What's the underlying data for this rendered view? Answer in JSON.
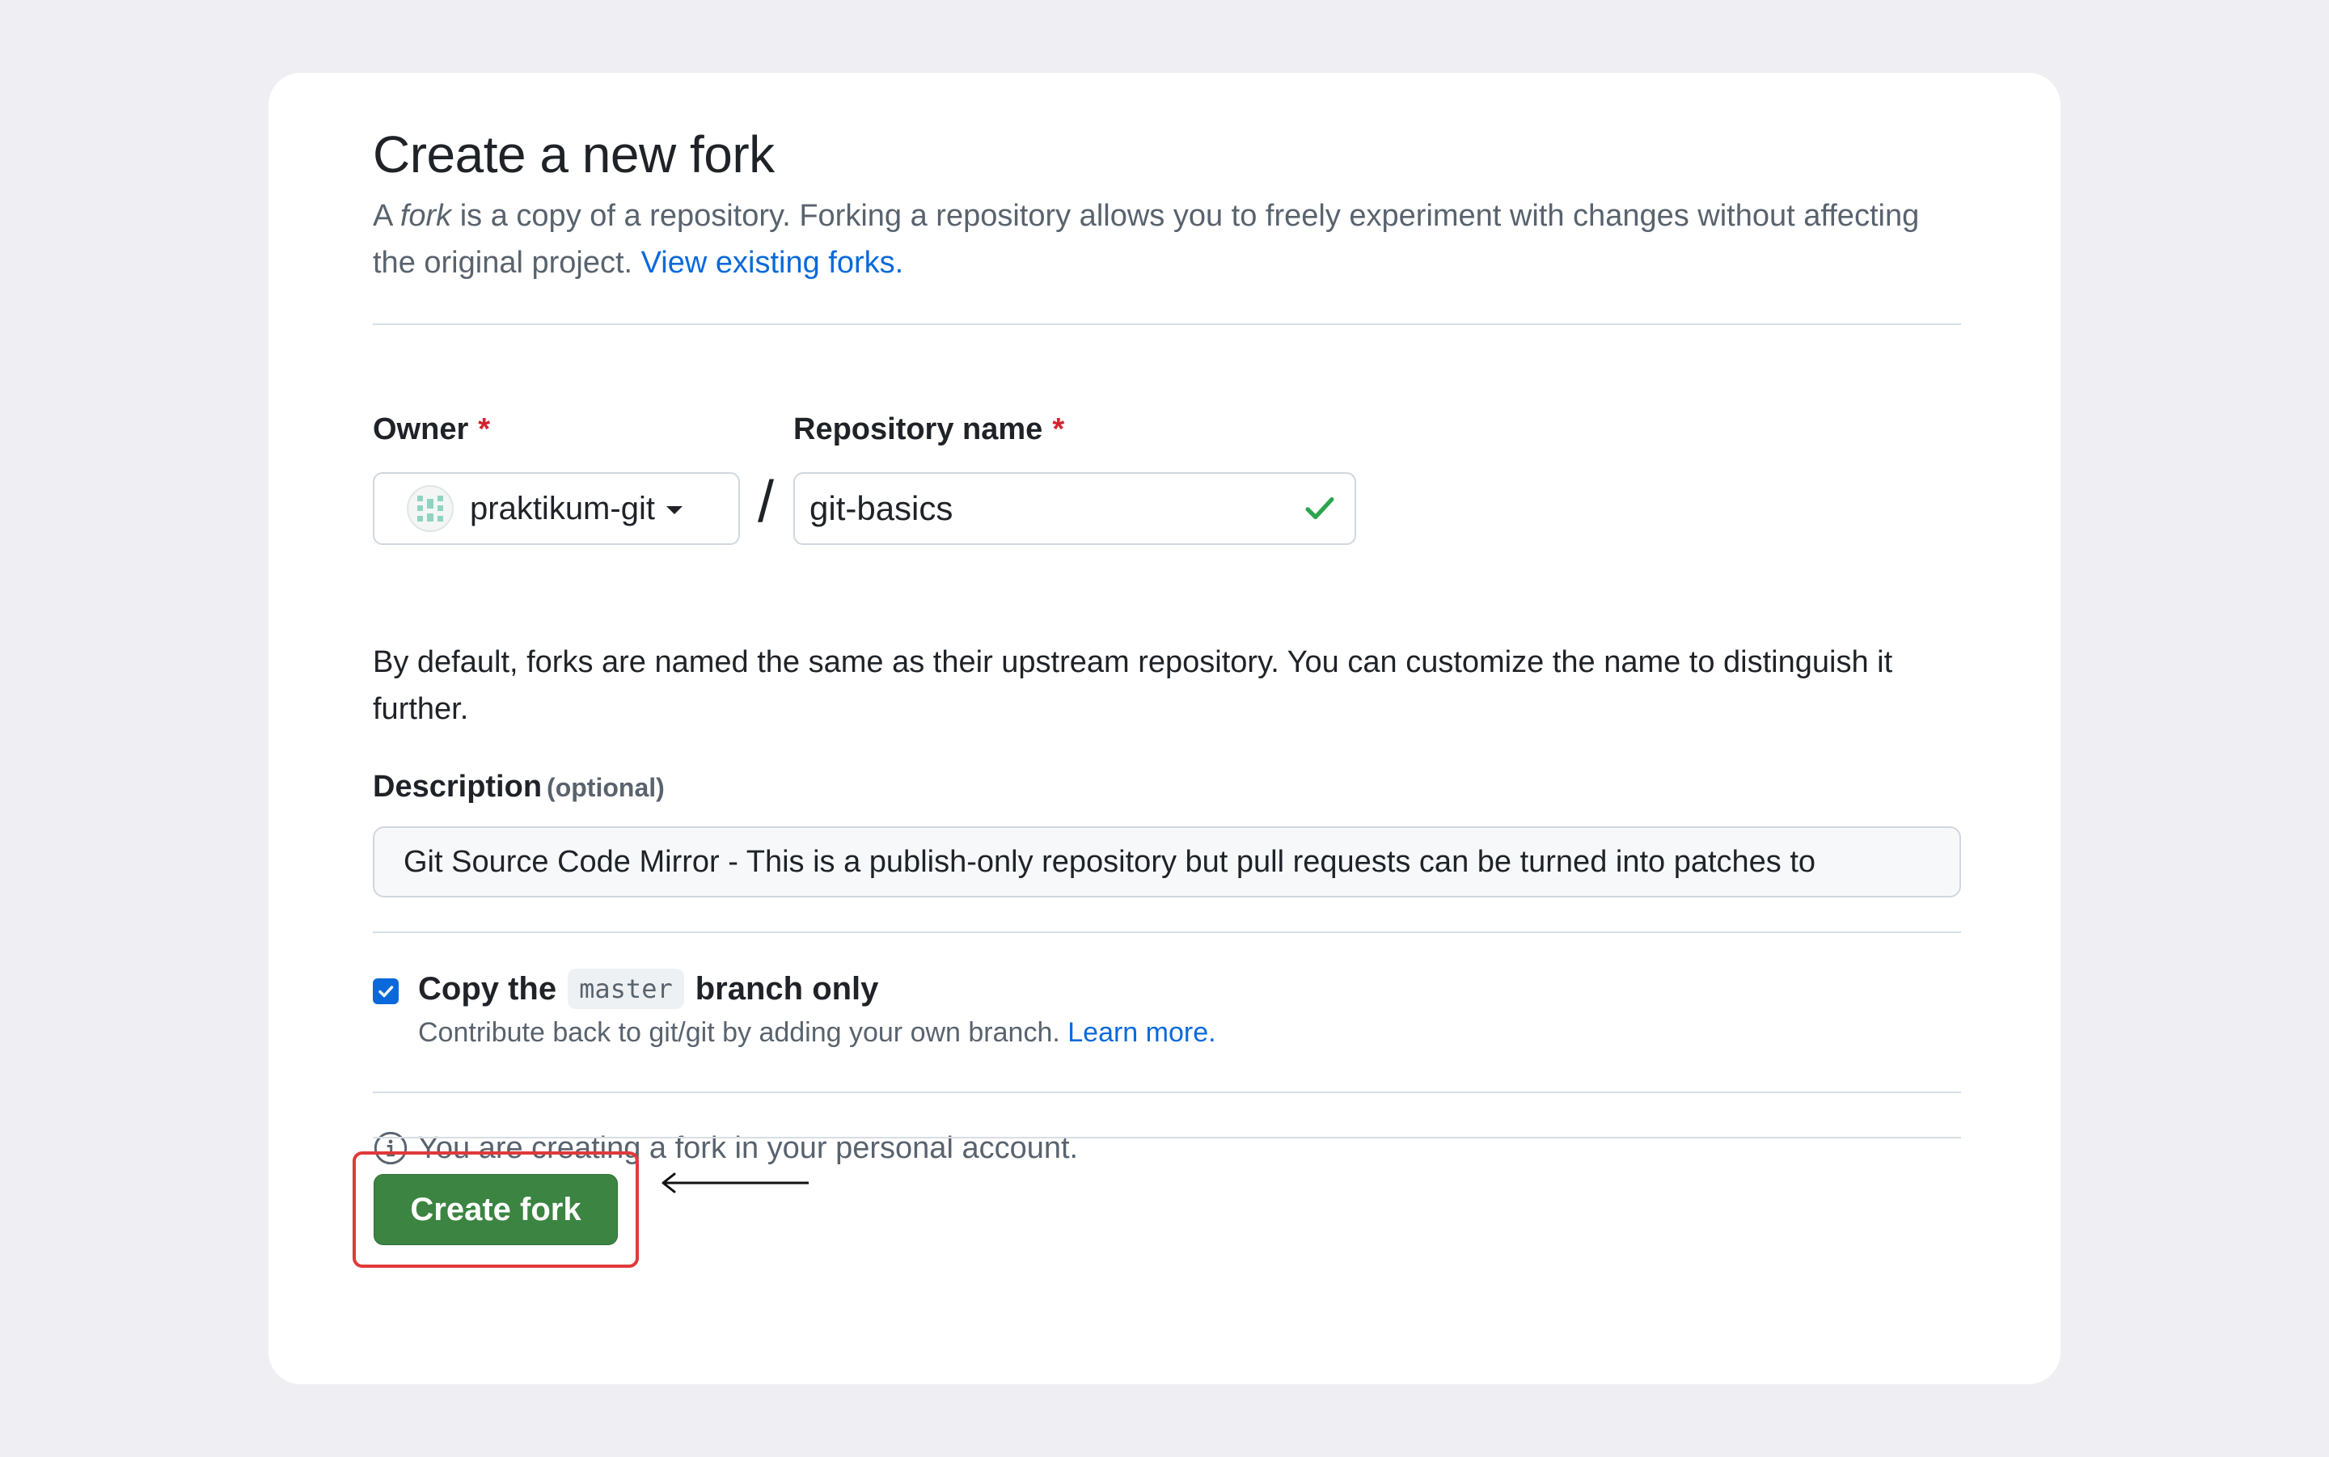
{
  "page": {
    "title": "Create a new fork",
    "intro_prefix": "A ",
    "intro_em": "fork",
    "intro_suffix": " is a copy of a repository. Forking a repository allows you to freely experiment with changes without affecting the original project. ",
    "view_forks_link": "View existing forks."
  },
  "owner": {
    "label": "Owner",
    "required_mark": "*",
    "value": "praktikum-git"
  },
  "separator": "/",
  "repository": {
    "label": "Repository name",
    "required_mark": "*",
    "value": "git-basics",
    "valid": true
  },
  "name_help": "By default, forks are named the same as their upstream repository. You can customize the name to distinguish it further.",
  "description": {
    "label": "Description",
    "optional": "(optional)",
    "value": "Git Source Code Mirror - This is a publish-only repository but pull requests can be turned into patches to"
  },
  "copy_branch": {
    "checked": true,
    "label_prefix": "Copy the",
    "branch": "master",
    "label_suffix": "branch only",
    "sub_text": "Contribute back to git/git by adding your own branch. ",
    "learn_more": "Learn more."
  },
  "info": {
    "icon": "info-icon",
    "text": "You are creating a fork in your personal account."
  },
  "actions": {
    "create_fork": "Create fork"
  },
  "annotation": {
    "highlight_color": "#e03a3a",
    "arrow": "left-arrow"
  },
  "colors": {
    "primary_button": "#3b8441",
    "link": "#0969da",
    "required": "#d1242f",
    "background": "#efeff3",
    "valid_check": "#2da44e"
  }
}
